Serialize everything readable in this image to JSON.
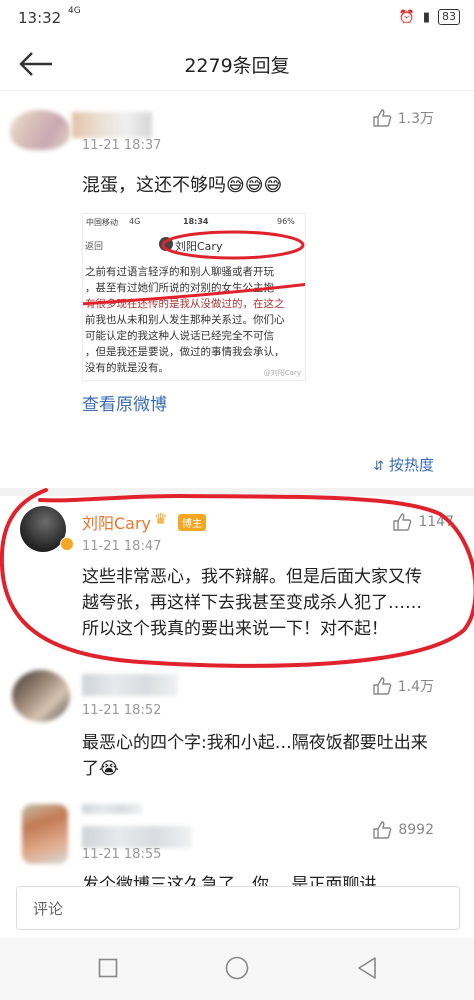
{
  "status_bar": {
    "time": "13:32",
    "network": "4G",
    "battery": "83"
  },
  "header": {
    "title": "2279条回复"
  },
  "top_comment": {
    "time": "11-21 18:37",
    "likes": "1.3万",
    "text": "混蛋，这还不够吗",
    "emojis": "😅😅😅",
    "link": "查看原微博",
    "embedded": {
      "status": {
        "carrier": "中国移动",
        "network": "4G",
        "time": "18:34",
        "battery": "96%"
      },
      "back": "返回",
      "user": "刘阳Cary",
      "lines": [
        "之前有过语言轻浮的和别人聊骚或者开玩",
        "，甚至有过她们所说的对别的女生公主抱",
        "有很多现在还传的是我从没做过的，在这之",
        "前我也从未和别人发生那种关系过。你们心",
        "可能认定的我这种人说话已经完全不可信",
        "，但是我还是要说，做过的事情我会承认，",
        "没有的就是没有。"
      ],
      "watermark": "@刘阳Cary"
    }
  },
  "sort_label": "按热度",
  "comments": [
    {
      "name": "刘阳Cary",
      "badge": "博主",
      "time": "11-21 18:47",
      "likes": "1147",
      "lines": [
        "这些非常恶心，我不辩解。但是后面大家又传",
        "越夸张，再这样下去我甚至变成杀人犯了……",
        "所以这个我真的要出来说一下！对不起！"
      ]
    },
    {
      "time": "11-21 18:52",
      "likes": "1.4万",
      "lines": [
        "最恶心的四个字:我和小起…隔夜饭都要吐出来",
        "了😭"
      ]
    },
    {
      "time": "11-21 18:55",
      "likes": "8992",
      "lines": [
        "发个微博三这久急了，你… 是正面聊讲"
      ]
    }
  ],
  "comment_input": {
    "placeholder": "评论"
  },
  "colors": {
    "link": "#3a6cb4",
    "highlight_circle": "#e0222c",
    "badge": "#f5a623"
  }
}
